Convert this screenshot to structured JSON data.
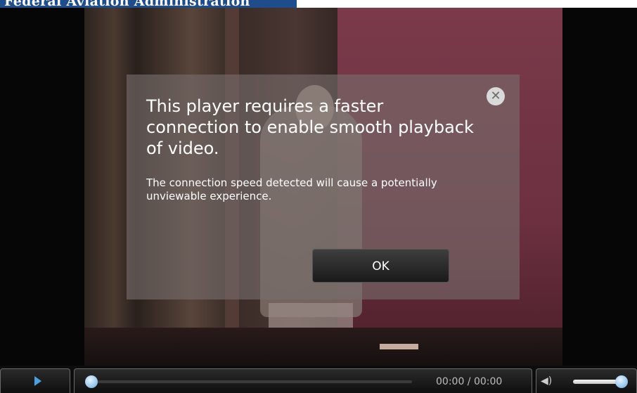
{
  "banner": {
    "title": "Federal Aviation Administration"
  },
  "dialog": {
    "heading": "This player requires a faster connection to enable smooth playback of video.",
    "message": "The connection speed detected will cause a potentially unviewable experience.",
    "ok_label": "OK",
    "close_glyph": "✕"
  },
  "controls": {
    "play_icon": "play-icon",
    "time": "00:00 / 00:00",
    "seek_progress": 0,
    "volume_level": 1.0,
    "accent_color": "#4aa0e0"
  }
}
